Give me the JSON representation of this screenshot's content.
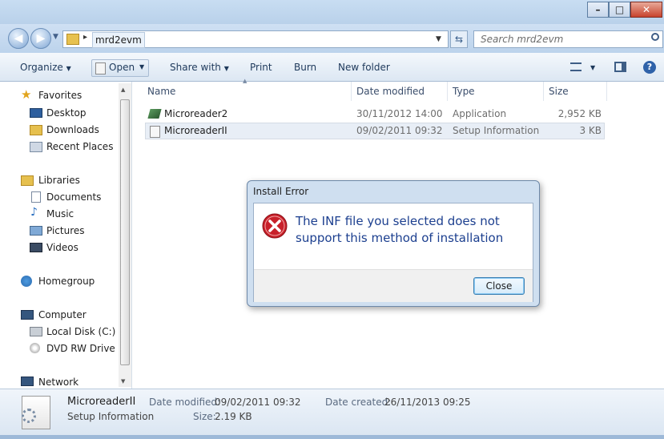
{
  "address": {
    "folder": "mrd2evm"
  },
  "search": {
    "placeholder": "Search mrd2evm"
  },
  "toolbar": {
    "organize": "Organize",
    "open": "Open",
    "share_with": "Share with",
    "print": "Print",
    "burn": "Burn",
    "new_folder": "New folder"
  },
  "nav": {
    "favorites": "Favorites",
    "desktop": "Desktop",
    "downloads": "Downloads",
    "recent": "Recent Places",
    "libraries": "Libraries",
    "documents": "Documents",
    "music": "Music",
    "pictures": "Pictures",
    "videos": "Videos",
    "homegroup": "Homegroup",
    "computer": "Computer",
    "local_disk": "Local Disk (C:)",
    "dvd": "DVD RW Drive (D",
    "network": "Network"
  },
  "columns": {
    "name": "Name",
    "date": "Date modified",
    "type": "Type",
    "size": "Size"
  },
  "files": [
    {
      "name": "Microreader2",
      "date": "30/11/2012 14:00",
      "type": "Application",
      "size": "2,952 KB"
    },
    {
      "name": "MicroreaderII",
      "date": "09/02/2011 09:32",
      "type": "Setup Information",
      "size": "3 KB"
    }
  ],
  "details": {
    "name": "MicroreaderII",
    "type": "Setup Information",
    "date_modified_label": "Date modified:",
    "date_modified": "09/02/2011 09:32",
    "size_label": "Size:",
    "size": "2.19 KB",
    "date_created_label": "Date created:",
    "date_created": "26/11/2013 09:25"
  },
  "dialog": {
    "title": "Install Error",
    "message": "The INF file you selected does not support this method of installation",
    "close_label": "Close"
  },
  "colors": {
    "accent": "#1c3f8f",
    "error": "#c8202a"
  }
}
